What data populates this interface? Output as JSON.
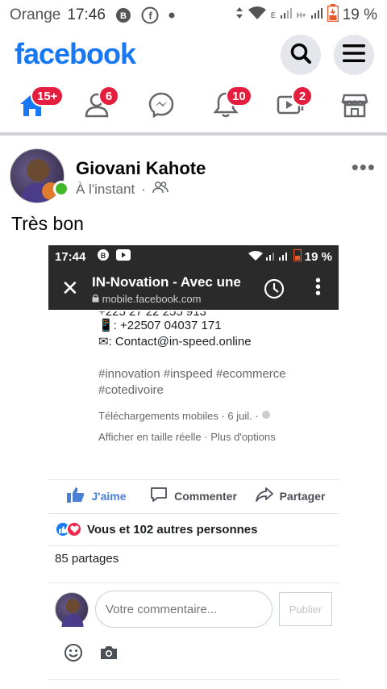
{
  "status_bar": {
    "carrier": "Orange",
    "time": "17:46",
    "battery": "19 %"
  },
  "header": {
    "logo": "facebook",
    "search_icon": "search-icon",
    "menu_icon": "hamburger-menu-icon"
  },
  "nav": {
    "items": [
      {
        "icon": "home-icon",
        "badge": "15+"
      },
      {
        "icon": "friends-icon",
        "badge": "6"
      },
      {
        "icon": "messenger-icon",
        "badge": ""
      },
      {
        "icon": "bell-icon",
        "badge": "10"
      },
      {
        "icon": "watch-icon",
        "badge": "2"
      },
      {
        "icon": "marketplace-icon",
        "badge": ""
      }
    ],
    "accent": "#1877f2",
    "badge_color": "#e41e3f"
  },
  "post": {
    "author": "Giovani Kahote",
    "time": "À l'instant",
    "separator": "·",
    "text": "Très bon",
    "embedded": {
      "status_time": "17:44",
      "status_battery": "19 %",
      "title": "IN-Novation - Avec une",
      "url": "mobile.facebook.com",
      "line_phone1": "+225 27 22 255 913",
      "line_phone2": ": +22507 04037 171",
      "line_email": ": Contact@in-speed.online",
      "hashtags1": "#innovation #inspeed #ecommerce",
      "hashtags2": "#cotedivoire",
      "meta": "Téléchargements mobiles · 6 juil. ·",
      "options": "Afficher en taille réelle · Plus d'options"
    },
    "actions": {
      "like": "J'aime",
      "comment": "Commenter",
      "share": "Partager"
    },
    "reactions_text": "Vous et 102 autres personnes",
    "shares_text": "85 partages",
    "comment_placeholder": "Votre commentaire...",
    "publish_label": "Publier"
  }
}
